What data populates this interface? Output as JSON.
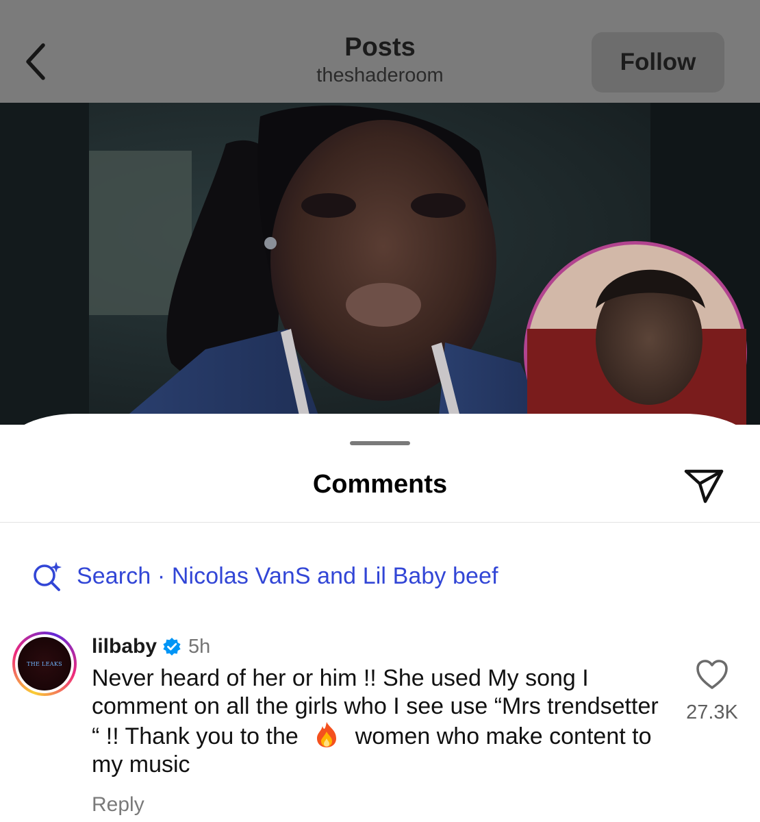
{
  "header": {
    "back_icon": "chevron-left-icon",
    "title": "Posts",
    "subtitle": "theshaderoom",
    "follow_label": "Follow"
  },
  "post": {
    "image_description": "",
    "inset_avatar": true
  },
  "comments_sheet": {
    "title": "Comments",
    "share_icon": "paper-plane-icon",
    "search": {
      "icon": "search-sparkle-icon",
      "label": "Search · Nicolas VanS and Lil Baby beef",
      "color": "#3246d6"
    },
    "comment": {
      "avatar_text": "THE LEAKS",
      "username": "lilbaby",
      "verified": true,
      "timestamp": "5h",
      "text_before_emoji": "Never heard of her or him !! She used My song I comment on all the girls who I see use “Mrs trendsetter “ !! Thank you to the",
      "emoji": "fire-emoji",
      "text_after_emoji": "women who make content to my music",
      "reply_label": "Reply",
      "like_icon": "heart-outline-icon",
      "like_count": "27.3K"
    }
  },
  "colors": {
    "dim_overlay": "#7b7b7b",
    "link_blue": "#3246d6",
    "verified_blue": "#0095f6"
  }
}
